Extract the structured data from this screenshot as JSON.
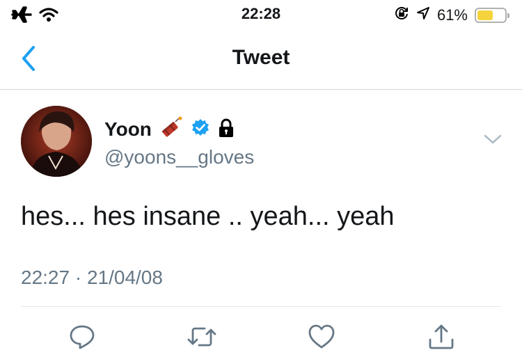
{
  "status_bar": {
    "time": "22:28",
    "battery_percent_label": "61%",
    "battery_level": 0.61,
    "left_icons": [
      "airplane-icon",
      "wifi-icon"
    ],
    "right_icons": [
      "orientation-lock-icon",
      "location-icon",
      "battery-icon"
    ]
  },
  "nav": {
    "title": "Tweet",
    "back_icon": "chevron-left-icon"
  },
  "tweet": {
    "author": {
      "display_name": "Yoon",
      "name_badges": [
        "firecracker-emoji",
        "verified-badge-icon",
        "lock-icon"
      ],
      "handle": "@yoons__gloves"
    },
    "text": "hes... hes insane .. yeah... yeah",
    "timestamp": "22:27 · 21/04/08"
  },
  "actions": [
    "reply-icon",
    "retweet-icon",
    "like-icon",
    "share-icon"
  ],
  "colors": {
    "accent": "#1da1f2",
    "secondary_text": "#657786",
    "battery": "#f5d33c",
    "icon_gray": "#657786"
  }
}
